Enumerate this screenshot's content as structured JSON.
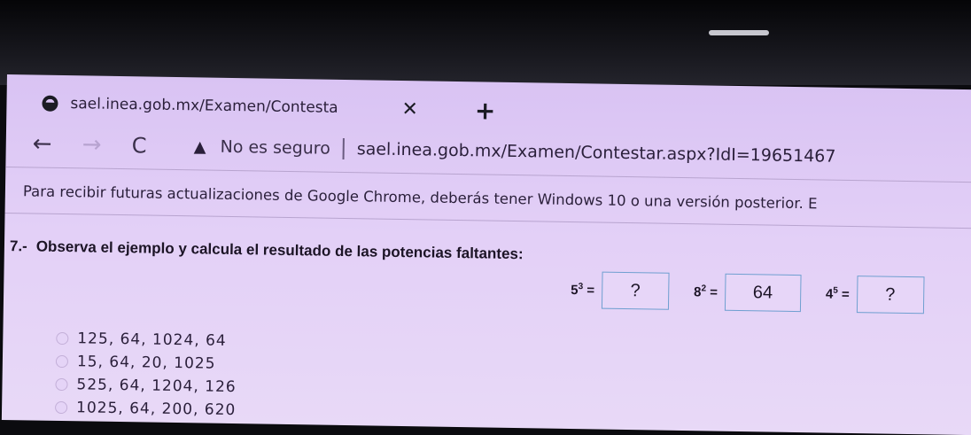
{
  "browser": {
    "tab_title": "sael.inea.gob.mx/Examen/Contesta",
    "tab_close": "✕",
    "new_tab": "+",
    "nav_back": "←",
    "nav_forward": "→",
    "nav_reload": "C",
    "security_warning": "No es seguro",
    "address_url": "sael.inea.gob.mx/Examen/Contestar.aspx?IdI=19651467"
  },
  "info_bar": {
    "text": "Para recibir futuras actualizaciones de Google Chrome, deberás tener Windows 10 o una versión posterior. E"
  },
  "question": {
    "number": "7.-",
    "text": "Observa el ejemplo y calcula el resultado de las potencias faltantes:",
    "powers": [
      {
        "base": "5",
        "exp": "3",
        "eq": "=",
        "answer": "?"
      },
      {
        "base": "8",
        "exp": "2",
        "eq": "=",
        "answer": "64"
      },
      {
        "base": "4",
        "exp": "5",
        "eq": "=",
        "answer": "?"
      }
    ],
    "options": [
      "125, 64, 1024, 64",
      "15, 64, 20, 1025",
      "525, 64, 1204, 126",
      "1025, 64, 200, 620"
    ]
  }
}
